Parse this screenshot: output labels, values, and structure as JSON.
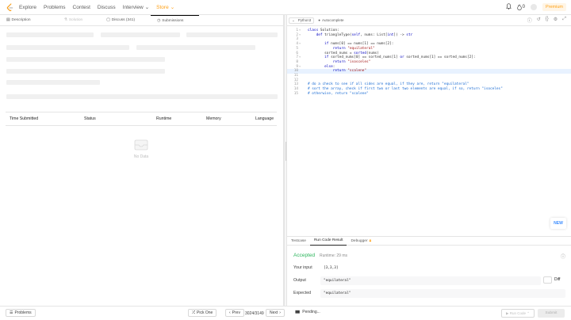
{
  "nav": {
    "items": [
      "Explore",
      "Problems",
      "Contest",
      "Discuss",
      "Interview",
      "Store"
    ],
    "right": {
      "notifications": "",
      "streak": "0",
      "premium": "Premium"
    }
  },
  "left": {
    "tabs": [
      "Description",
      "Solution",
      "Discuss (341)",
      "Submissions"
    ],
    "table_headers": [
      "Time Submitted",
      "Status",
      "Runtime",
      "Memory",
      "Language"
    ],
    "empty_text": "No Data"
  },
  "editor": {
    "language": "Python3",
    "autocomplete": "Autocomplete",
    "lines": [
      {
        "n": "1",
        "fold": "▾",
        "html": "<span class=\"kw\">class</span> Solution:"
      },
      {
        "n": "2",
        "fold": "▾",
        "html": "    <span class=\"kw\">def</span> triangleType(<span class=\"kw\">self</span>, nums: List[<span class=\"kw\">int</span>]) -&gt; <span class=\"kw\">str</span>"
      },
      {
        "n": "3",
        "fold": "",
        "html": ""
      },
      {
        "n": "4",
        "fold": "▾",
        "html": "        <span class=\"kw\">if</span> nums[0] == nums[1] == nums[2]:"
      },
      {
        "n": "5",
        "fold": "",
        "html": "            <span class=\"kw\">return</span> <span class=\"str\">\"equilateral\"</span>"
      },
      {
        "n": "6",
        "fold": "",
        "html": "        sorted_nums = <span class=\"kw\">sorted</span>(nums)"
      },
      {
        "n": "7",
        "fold": "▾",
        "html": "        <span class=\"kw\">if</span> sorted_nums[0] == sorted_nums[1] <span class=\"kw\">or</span> sorted_nums[1] == sorted_nums[2]:"
      },
      {
        "n": "8",
        "fold": "",
        "html": "            <span class=\"kw\">return</span> <span class=\"str\">\"isosceles\"</span>"
      },
      {
        "n": "9",
        "fold": "▾",
        "html": "        <span class=\"kw\">else</span>:"
      },
      {
        "n": "10",
        "fold": "",
        "html": "            <span class=\"kw\">return</span> <span class=\"str\">\"scalene\"</span>"
      },
      {
        "n": "11",
        "fold": "",
        "html": ""
      },
      {
        "n": "12",
        "fold": "",
        "html": ""
      },
      {
        "n": "13",
        "fold": "",
        "html": "<span class=\"cm\"># do a check to see if all sides are equal, if they are, return \"equilateral\"</span>"
      },
      {
        "n": "14",
        "fold": "",
        "html": "<span class=\"cm\"># sort the array, check if first two or last two elements are equal, if so, return \"isoceles\"</span>"
      },
      {
        "n": "15",
        "fold": "",
        "html": "<span class=\"cm\"># otherwise, return \"scalene\"</span>"
      }
    ],
    "highlighted_line": 10,
    "new_badge": "NEW"
  },
  "result_tabs": [
    "Testcase",
    "Run Code Result",
    "Debugger"
  ],
  "result": {
    "status": "Accepted",
    "runtime": "Runtime: 29 ms",
    "your_input_label": "Your input",
    "your_input": "[3,3,3]",
    "output_label": "Output",
    "output": "\"equilateral\"",
    "diff_label": "Diff",
    "expected_label": "Expected",
    "expected": "\"equilateral\""
  },
  "bottom": {
    "problems": "Problems",
    "pick_one": "Pick One",
    "prev": "Prev",
    "page": "3024/3149",
    "next": "Next",
    "pending": "Pending...",
    "run_code": "Run Code",
    "submit": "Submit"
  },
  "colors": {
    "accent": "#ffa116",
    "accepted": "#2db55d",
    "new": "#3b8cff"
  }
}
